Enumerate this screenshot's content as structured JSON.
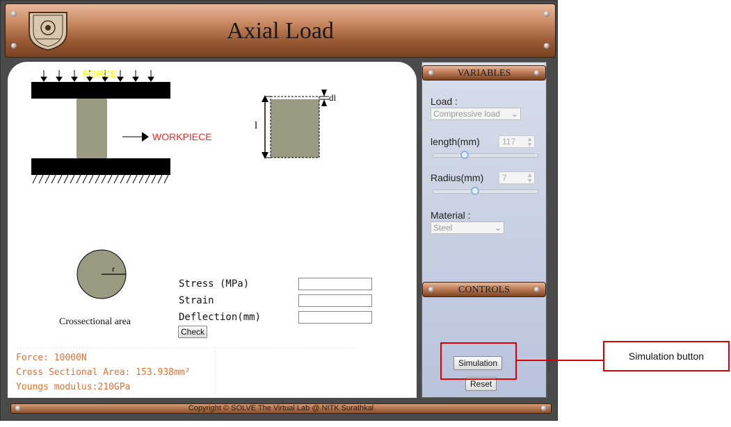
{
  "header": {
    "title": "Axial Load"
  },
  "diagram": {
    "force_label": "FORCE",
    "workpiece_label": "WORKPIECE",
    "length_symbol": "l",
    "deflection_symbol": "dl",
    "radius_symbol": "r",
    "cross_section_label": "Crossectional area"
  },
  "results": {
    "stress_label": "Stress (MPa)",
    "strain_label": "Strain",
    "deflection_label": "Deflection(mm)",
    "check_label": "Check",
    "stress_value": "",
    "strain_value": "",
    "deflection_value": ""
  },
  "info": {
    "force": "Force: 10000N",
    "area": "Cross Sectional Area: 153.938mm²",
    "modulus": "Youngs modulus:210GPa"
  },
  "variables": {
    "header": "VARIABLES",
    "load_label": "Load :",
    "load_value": "Compressive load",
    "length_label": "length(mm)",
    "length_value": "117",
    "length_fraction": 0.3,
    "radius_label": "Radius(mm)",
    "radius_value": "7",
    "radius_fraction": 0.4,
    "material_label": "Material :",
    "material_value": "Steel"
  },
  "controls": {
    "header": "CONTROLS",
    "simulation_label": "Simulation",
    "reset_label": "Reset"
  },
  "annotation": {
    "label": "Simulation button",
    "color": "#e00000"
  },
  "footer": {
    "copyright": "Copyright © SOLVE The Virtual Lab @ NITK Surathkal"
  }
}
